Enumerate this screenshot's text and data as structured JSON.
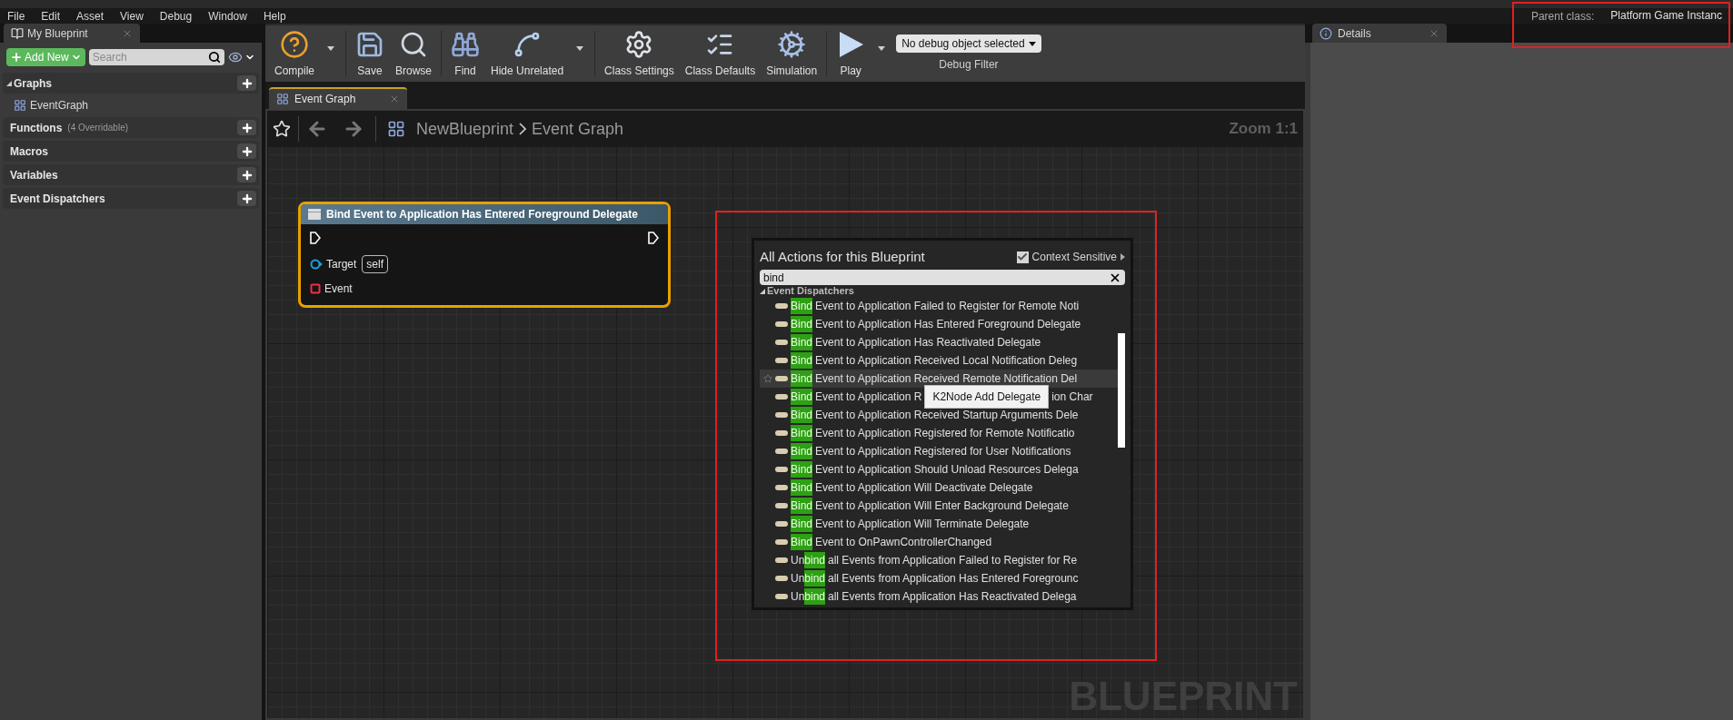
{
  "menu_bar": [
    "File",
    "Edit",
    "Asset",
    "View",
    "Debug",
    "Window",
    "Help"
  ],
  "parent_class": {
    "label": "Parent class:",
    "value": "Platform Game Instanc"
  },
  "my_blueprint": {
    "tab": "My Blueprint",
    "add_button": "Add New",
    "search_placeholder": "Search",
    "sections": [
      {
        "kind": "header",
        "title": "Graphs",
        "expanded": true
      },
      {
        "kind": "item",
        "title": "EventGraph"
      },
      {
        "kind": "header",
        "title": "Functions",
        "note": "(4 Overridable)"
      },
      {
        "kind": "header",
        "title": "Macros"
      },
      {
        "kind": "header",
        "title": "Variables"
      },
      {
        "kind": "header",
        "title": "Event Dispatchers"
      }
    ]
  },
  "toolbar": [
    {
      "kind": "compile",
      "label": "Compile",
      "dropdown": true
    },
    {
      "kind": "save",
      "label": "Save"
    },
    {
      "kind": "browse",
      "label": "Browse"
    },
    {
      "kind": "find",
      "label": "Find"
    },
    {
      "kind": "hide",
      "label": "Hide Unrelated",
      "dropdown": true
    },
    {
      "kind": "settings",
      "label": "Class Settings"
    },
    {
      "kind": "defaults",
      "label": "Class Defaults"
    },
    {
      "kind": "simulation",
      "label": "Simulation"
    },
    {
      "kind": "play",
      "label": "Play",
      "dropdown": true
    }
  ],
  "debug_filter": {
    "value": "No debug object selected",
    "label": "Debug Filter"
  },
  "graph_tab": "Event Graph",
  "breadcrumb": [
    "NewBlueprint",
    "Event Graph"
  ],
  "zoom": "Zoom 1:1",
  "watermark": "BLUEPRINT",
  "node": {
    "title": "Bind Event to Application Has Entered Foreground Delegate",
    "selected": true,
    "target_label": "Target",
    "target_value": "self",
    "event_label": "Event"
  },
  "action_menu": {
    "title": "All Actions for this Blueprint",
    "context_sensitive": {
      "label": "Context Sensitive",
      "checked": true
    },
    "search": "bind",
    "category": "Event Dispatchers",
    "tooltip": "K2Node Add Delegate",
    "rows": [
      {
        "prefix": "",
        "match": "Bind",
        "suffix": "Event to Application Failed to Register for Remote Noti",
        "selected": false
      },
      {
        "prefix": "",
        "match": "Bind",
        "suffix": "Event to Application Has Entered Foreground Delegate",
        "selected": false
      },
      {
        "prefix": "",
        "match": "Bind",
        "suffix": "Event to Application Has Reactivated Delegate",
        "selected": false
      },
      {
        "prefix": "",
        "match": "Bind",
        "suffix": "Event to Application Received Local Notification Deleg",
        "selected": false
      },
      {
        "prefix": "",
        "match": "Bind",
        "suffix": "Event to Application Received Remote Notification Del",
        "selected": true
      },
      {
        "prefix": "",
        "match": "Bind",
        "suffix": "Event to Application R",
        "tail": "ion Char",
        "selected": false
      },
      {
        "prefix": "",
        "match": "Bind",
        "suffix": "Event to Application Received Startup Arguments Dele",
        "selected": false
      },
      {
        "prefix": "",
        "match": "Bind",
        "suffix": "Event to Application Registered for Remote Notificatio",
        "selected": false
      },
      {
        "prefix": "",
        "match": "Bind",
        "suffix": "Event to Application Registered for User Notifications",
        "selected": false
      },
      {
        "prefix": "",
        "match": "Bind",
        "suffix": "Event to Application Should Unload Resources Delega",
        "selected": false
      },
      {
        "prefix": "",
        "match": "Bind",
        "suffix": "Event to Application Will Deactivate Delegate",
        "selected": false
      },
      {
        "prefix": "",
        "match": "Bind",
        "suffix": "Event to Application Will Enter Background Delegate",
        "selected": false
      },
      {
        "prefix": "",
        "match": "Bind",
        "suffix": "Event to Application Will Terminate Delegate",
        "selected": false
      },
      {
        "prefix": "",
        "match": "Bind",
        "suffix": "Event to OnPawnControllerChanged",
        "selected": false
      },
      {
        "prefix": "Un",
        "match": "bind",
        "suffix": "all Events from Application Failed to Register for Re",
        "selected": false
      },
      {
        "prefix": "Un",
        "match": "bind",
        "suffix": "all Events from Application Has Entered Foregrounc",
        "selected": false
      },
      {
        "prefix": "Un",
        "match": "bind",
        "suffix": "all Events from Application Has Reactivated Delega",
        "selected": false
      }
    ]
  },
  "details_tab": "Details"
}
